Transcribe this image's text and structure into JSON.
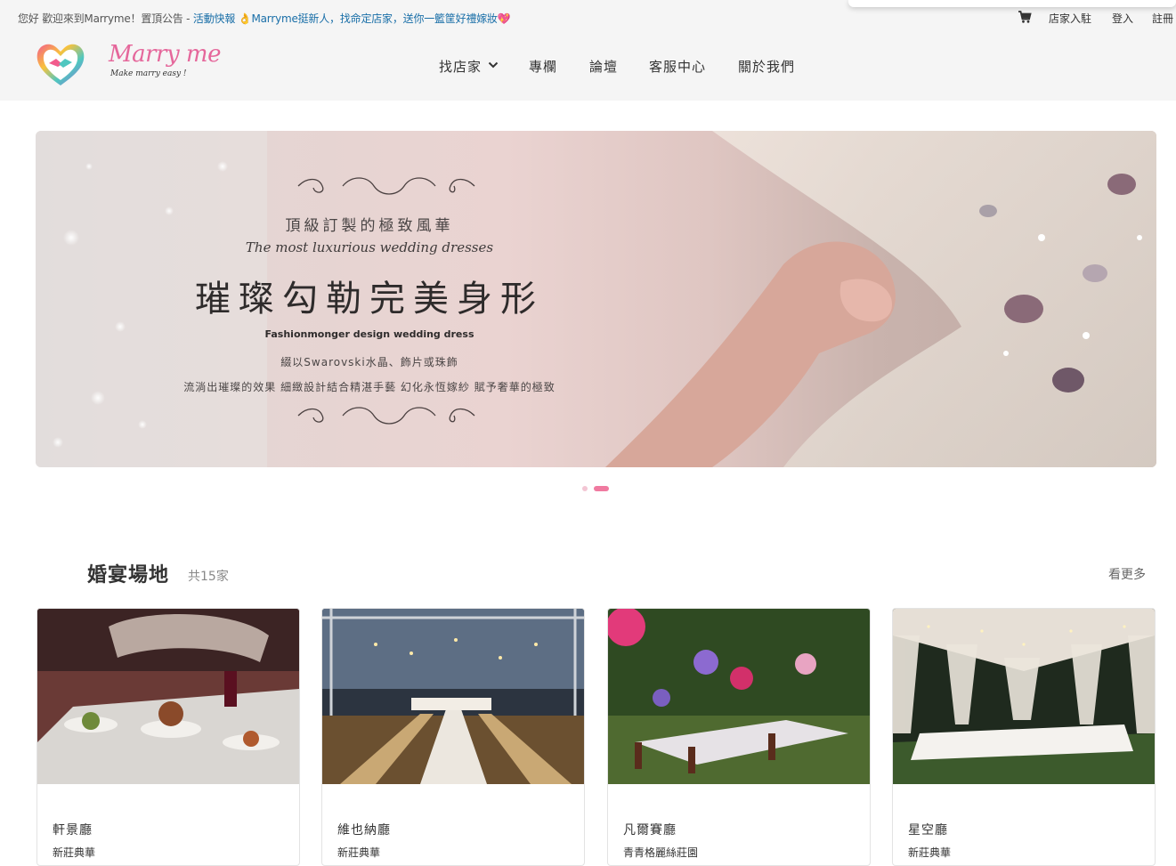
{
  "announcement": {
    "greeting": "您好 歡迎來到Marryme！置頂公告 - ",
    "link1": "活動快報",
    "hand": "👌",
    "link2": "Marryme挺新人，找命定店家，送你一籃筐好禮嫁妝",
    "heart": "💖"
  },
  "utility": {
    "cart_icon": "cart-icon",
    "vendor_join": "店家入駐",
    "login": "登入",
    "register": "註冊"
  },
  "logo": {
    "text": "Marry me",
    "tagline": "Make marry easy !"
  },
  "nav": {
    "items": [
      {
        "label": "找店家",
        "icon": "chevron-down-icon"
      },
      {
        "label": "專欄"
      },
      {
        "label": "論壇"
      },
      {
        "label": "客服中心"
      },
      {
        "label": "關於我們"
      }
    ]
  },
  "banner": {
    "subtitle": "頂級訂製的極致風華",
    "english": "The most luxurious wedding dresses",
    "headline": "璀璨勾勒完美身形",
    "tagline": "Fashionmonger design wedding dress",
    "desc1": "綴以Swarovski水晶、飾片或珠飾",
    "desc2": "流淌出璀璨的效果 細緻設計結合精湛手藝 幻化永恆嫁紗 賦予奢華的極致",
    "slides": 2,
    "active_slide": 2
  },
  "section": {
    "title": "婚宴場地",
    "count": "共15家",
    "see_more": "看更多"
  },
  "cards": [
    {
      "name": "軒景廳",
      "tag": "新莊典華"
    },
    {
      "name": "維也納廳",
      "tag": "新莊典華"
    },
    {
      "name": "凡爾賽廳",
      "tag": "青青格麗絲莊園"
    },
    {
      "name": "星空廳",
      "tag": "新莊典華"
    }
  ],
  "colors": {
    "accent": "#f07aa0",
    "link": "#1a6fa8",
    "header_bg": "#f5f5f5"
  }
}
